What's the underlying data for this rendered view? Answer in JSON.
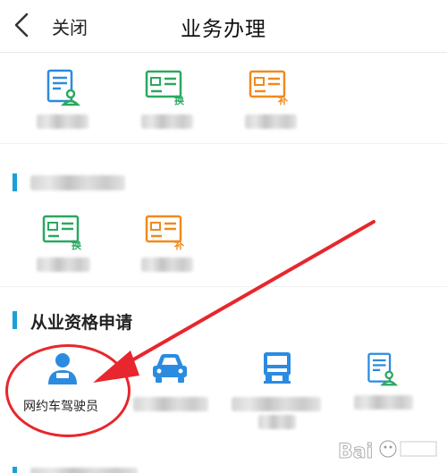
{
  "header": {
    "close_label": "关闭",
    "title": "业务办理"
  },
  "sections": {
    "qualification": {
      "title": "从业资格申请"
    }
  },
  "qualification_items": {
    "ride_hailing_driver": "网约车驾驶员"
  },
  "watermark": {
    "text": "Bai"
  },
  "colors": {
    "accent": "#1aa0d8",
    "icon_blue": "#2b8be0",
    "icon_green": "#2aa860",
    "icon_orange": "#f08a1c",
    "annotation_red": "#e8262d"
  }
}
